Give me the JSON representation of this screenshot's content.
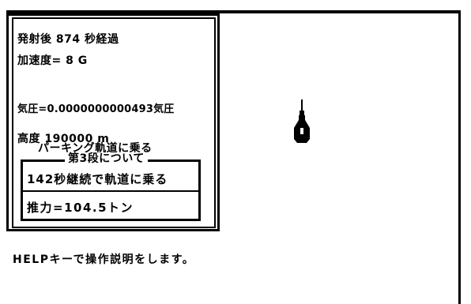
{
  "telemetry": {
    "elapsed": "発射後 874 秒経過",
    "acceleration": "加速度= 8 G",
    "pressure": "気圧=0.0000000000493気圧",
    "altitude": "高度 190000 m",
    "mode": "パーキング軌道に乗る"
  },
  "stage": {
    "title": "第3段について",
    "orbit_msg": "142秒継続で軌道に乗る",
    "thrust": "推力=104.5トン"
  },
  "help_text": "HELPキーで操作説明をします。",
  "colors": {
    "background": "#ffffff",
    "ink": "#000000"
  },
  "icons": {
    "rocket": "rocket-icon"
  }
}
